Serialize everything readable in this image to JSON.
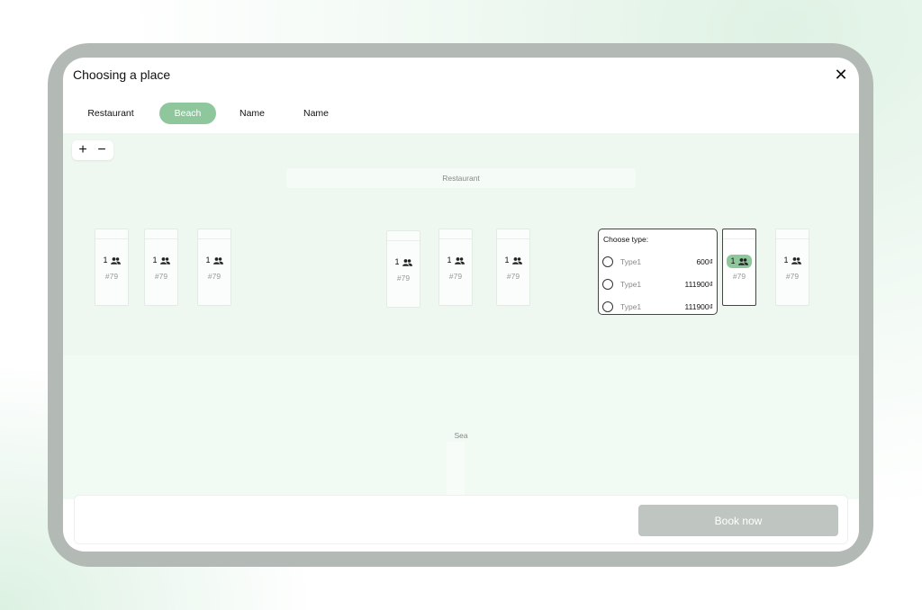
{
  "dialog": {
    "title": "Choosing a place",
    "close_icon": "close-icon"
  },
  "tabs": [
    {
      "label": "Restaurant",
      "active": false
    },
    {
      "label": "Beach",
      "active": true
    },
    {
      "label": "Name",
      "active": false
    },
    {
      "label": "Name",
      "active": false
    }
  ],
  "zoom": {
    "plus": "+",
    "minus": "−"
  },
  "map": {
    "restaurant_label": "Restaurant",
    "sea_label": "Sea",
    "loungers": [
      {
        "capacity": "1",
        "number": "#79",
        "selected": false
      },
      {
        "capacity": "1",
        "number": "#79",
        "selected": false
      },
      {
        "capacity": "1",
        "number": "#79",
        "selected": false
      },
      {
        "capacity": "1",
        "number": "#79",
        "selected": false
      },
      {
        "capacity": "1",
        "number": "#79",
        "selected": false
      },
      {
        "capacity": "1",
        "number": "#79",
        "selected": false
      },
      {
        "capacity": "1",
        "number": "#79",
        "selected": true
      },
      {
        "capacity": "1",
        "number": "#79",
        "selected": false
      }
    ]
  },
  "popup": {
    "title": "Choose type:",
    "options": [
      {
        "name": "Type1",
        "price": "600₫"
      },
      {
        "name": "Type1",
        "price": "111900₫"
      },
      {
        "name": "Type1",
        "price": "111900₫"
      }
    ]
  },
  "footer": {
    "book_label": "Book now"
  },
  "colors": {
    "accent": "#8fc79d",
    "map_bg": "#eef8f0",
    "disabled_button": "#bfc5c1"
  }
}
